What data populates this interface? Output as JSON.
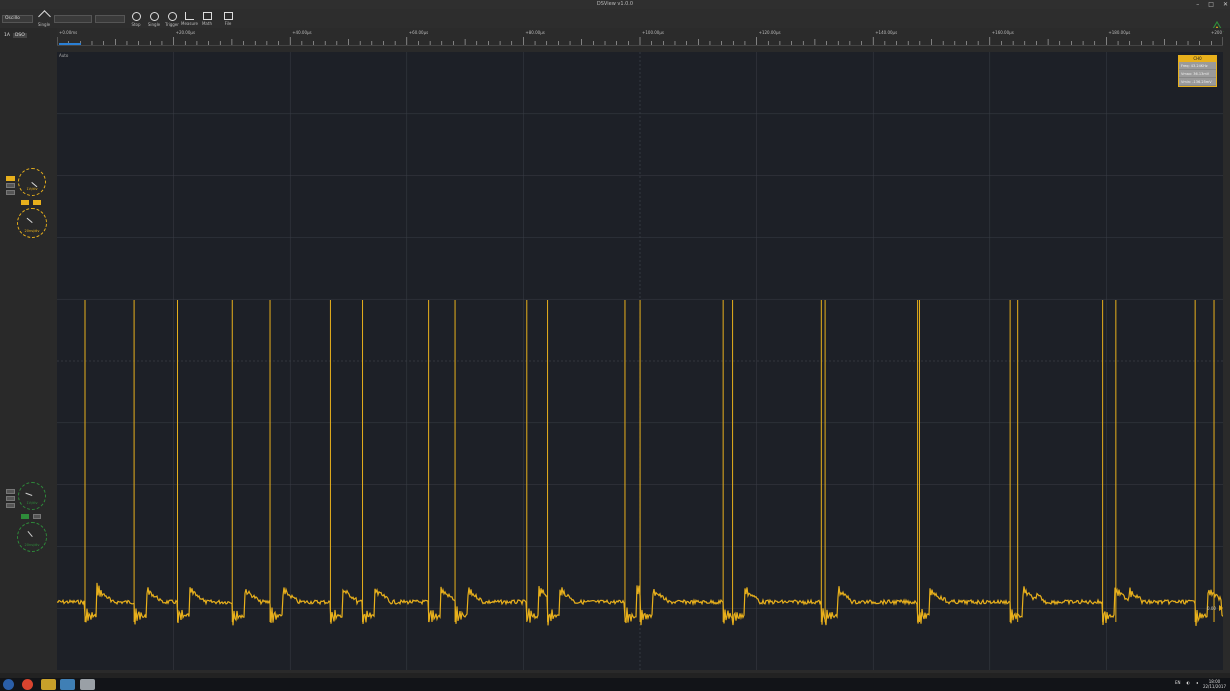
{
  "window": {
    "title": "DSView v1.0.0"
  },
  "toolbar": {
    "mode_select": "Oscillo",
    "buttons": [
      {
        "label": "Single"
      },
      {
        "label": "Stop"
      },
      {
        "label": "Single"
      },
      {
        "label": "Trigger"
      },
      {
        "label": "Measure"
      },
      {
        "label": "Math"
      },
      {
        "label": "File"
      }
    ]
  },
  "left_panel": {
    "run_label": "1A",
    "run_value": "DSO",
    "ch0_knob_label": "1V/div",
    "ch0_knob2_label": "20ns/div",
    "ch1_knob_label": "1V/div",
    "ch1_knob2_label": "20ns/div",
    "ch1_on": "ON",
    "ch1_off": "X1"
  },
  "ruler": {
    "ticks": [
      "+0.00ms",
      "+20.00μs",
      "+40.00μs",
      "+60.00μs",
      "+80.00μs",
      "+100.00μs",
      "+120.00μs",
      "+140.00μs",
      "+160.00μs",
      "+180.00μs",
      "+200"
    ]
  },
  "plot": {
    "label": "Auto",
    "trigger_marker": "0.00",
    "colors": {
      "trace": "#e8b01c",
      "grid": "#3a3e47",
      "bg": "#1d2027"
    }
  },
  "measure_panel": {
    "header": "CH0",
    "rows": [
      "Freq: 43.24KHz",
      "Vmax: 36.13mV",
      "Vmin: -136.25mV"
    ]
  },
  "taskbar": {
    "icons": [
      "windows-start",
      "chrome",
      "taxi",
      "dsview",
      "app"
    ],
    "tray": "EN",
    "time": "18:00",
    "date": "22/11/2017"
  }
}
